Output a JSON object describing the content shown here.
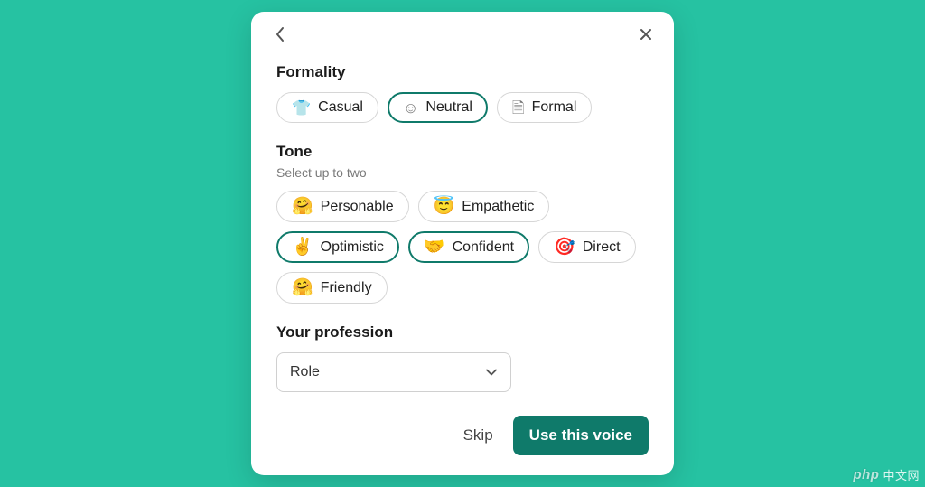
{
  "formality": {
    "title": "Formality",
    "options": [
      {
        "label": "Casual",
        "glyph": "👕",
        "outline": true,
        "selected": false
      },
      {
        "label": "Neutral",
        "glyph": "☺",
        "outline": true,
        "selected": true
      },
      {
        "label": "Formal",
        "glyph": "🗎",
        "outline": true,
        "selected": false
      }
    ]
  },
  "tone": {
    "title": "Tone",
    "subtitle": "Select up to two",
    "options": [
      {
        "label": "Personable",
        "emoji": "🤗",
        "selected": false
      },
      {
        "label": "Empathetic",
        "emoji": "😇",
        "selected": false
      },
      {
        "label": "Optimistic",
        "emoji": "✌️",
        "selected": true
      },
      {
        "label": "Confident",
        "emoji": "🤝",
        "selected": true
      },
      {
        "label": "Direct",
        "emoji": "🎯",
        "selected": false
      },
      {
        "label": "Friendly",
        "emoji": "🤗",
        "selected": false
      }
    ]
  },
  "profession": {
    "title": "Your profession",
    "placeholder": "Role"
  },
  "footer": {
    "skip_label": "Skip",
    "primary_label": "Use this voice"
  },
  "watermark": {
    "brand": "php",
    "text": "中文网"
  }
}
